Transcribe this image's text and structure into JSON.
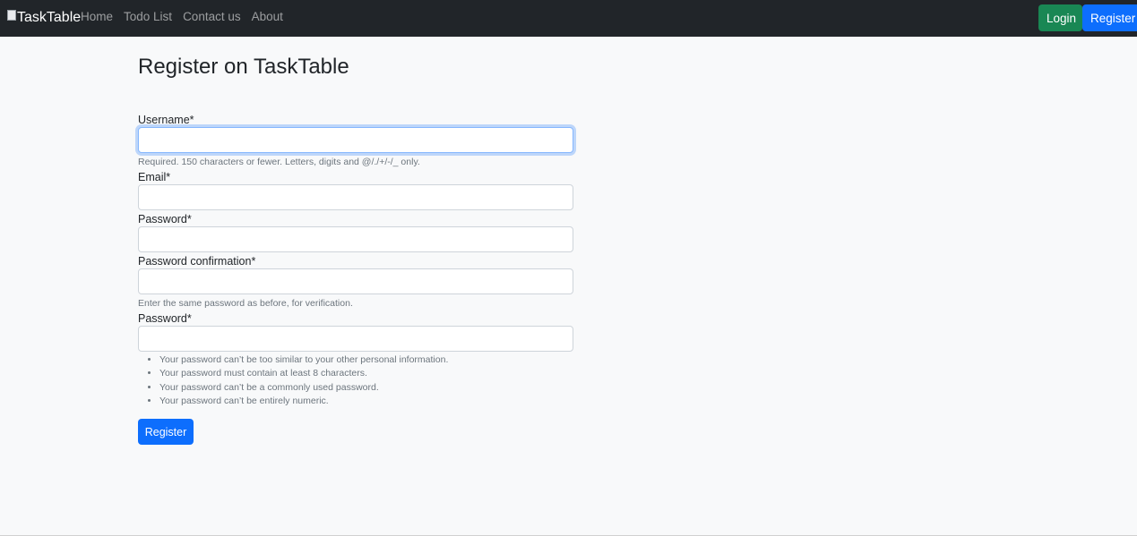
{
  "navbar": {
    "brand": "TaskTable",
    "links": [
      "Home",
      "Todo List",
      "Contact us",
      "About"
    ],
    "login_label": "Login",
    "register_label": "Register"
  },
  "page": {
    "title": "Register on TaskTable"
  },
  "form": {
    "username": {
      "label": "Username*",
      "value": "",
      "help": "Required. 150 characters or fewer. Letters, digits and @/./+/-/_ only."
    },
    "email": {
      "label": "Email*",
      "value": ""
    },
    "password": {
      "label": "Password*",
      "value": ""
    },
    "password_confirmation": {
      "label": "Password confirmation*",
      "value": "",
      "help": "Enter the same password as before, for verification."
    },
    "password2": {
      "label": "Password*",
      "value": "",
      "rules": [
        "Your password can’t be too similar to your other personal information.",
        "Your password must contain at least 8 characters.",
        "Your password can’t be a commonly used password.",
        "Your password can’t be entirely numeric."
      ]
    },
    "submit_label": "Register"
  },
  "colors": {
    "navbar_bg": "#212529",
    "login_btn": "#198754",
    "primary_btn": "#0d6efd",
    "page_bg": "#f8f9fa"
  }
}
